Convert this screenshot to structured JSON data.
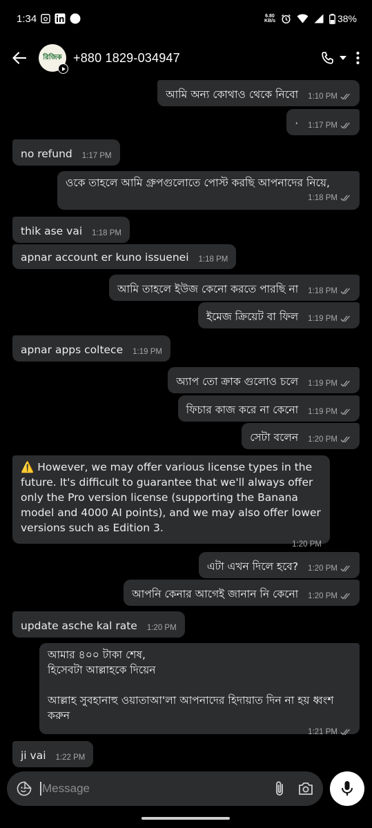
{
  "status_bar": {
    "time": "1:34",
    "net_speed_top": "6.80",
    "net_speed_bottom": "KB/s",
    "battery": "38%"
  },
  "header": {
    "contact_name": "+880 1829-034947",
    "avatar_text": "রিজিক"
  },
  "messages": [
    {
      "dir": "out",
      "text": "আমি অন্য কোথাও থেকে নিবো",
      "time": "1:10 PM"
    },
    {
      "dir": "out",
      "text": "·",
      "time": "1:17 PM"
    },
    {
      "dir": "in",
      "text": "no refund",
      "time": "1:17 PM"
    },
    {
      "dir": "out",
      "text": "ওকে তাহলে আমি গ্রুপগুলোতে পোস্ট করছি আপনাদের নিয়ে,",
      "time": "1:18 PM"
    },
    {
      "dir": "in",
      "text": "thik ase vai",
      "time": "1:18 PM"
    },
    {
      "dir": "in",
      "text": "apnar account er kuno issuenei",
      "time": "1:18 PM"
    },
    {
      "dir": "out",
      "text": "আমি তাহলে ইউজ কেনো করতে পারছি না",
      "time": "1:18 PM"
    },
    {
      "dir": "out",
      "text": "ইমেজ ক্রিয়েট বা ফিল",
      "time": "1:19 PM"
    },
    {
      "dir": "in",
      "text": "apnar apps coltece",
      "time": "1:19 PM"
    },
    {
      "dir": "out",
      "text": "অ্যাপ তো ক্রাক গুলোও চলে",
      "time": "1:19 PM"
    },
    {
      "dir": "out",
      "text": "ফিচার কাজ করে না কেনো",
      "time": "1:19 PM"
    },
    {
      "dir": "out",
      "text": "সেটা বলেন",
      "time": "1:20 PM"
    },
    {
      "dir": "in",
      "text": "⚠️ However, we may offer various license types in the future. It's difficult to guarantee that we'll always offer only the Pro version license (supporting the Banana model and 4000 AI points), and we may also offer lower versions such as Edition 3.",
      "time": "1:20 PM"
    },
    {
      "dir": "out",
      "text": "এটা এখন দিলে হবে?",
      "time": "1:20 PM"
    },
    {
      "dir": "out",
      "text": "আপনি কেনার আগেই জানান নি কেনো",
      "time": "1:20 PM"
    },
    {
      "dir": "in",
      "text": "update asche kal rate",
      "time": "1:20 PM"
    },
    {
      "dir": "out",
      "text": "আমার ৪০০ টাকা শেষ,\nহিসেবটা আল্লাহকে দিয়েন\n\nআল্লাহ সুবহানাহু ওয়াতাআ'লা আপনাদের হিদায়াত দিন না হয় ধ্বংশ করুন",
      "time": "1:21 PM"
    },
    {
      "dir": "in",
      "text": "ji vai",
      "time": "1:22 PM"
    }
  ],
  "composer": {
    "placeholder": "Message"
  },
  "colors": {
    "bubble": "#2c2d2f",
    "background": "#000000",
    "tick": "#a8a8a8"
  }
}
